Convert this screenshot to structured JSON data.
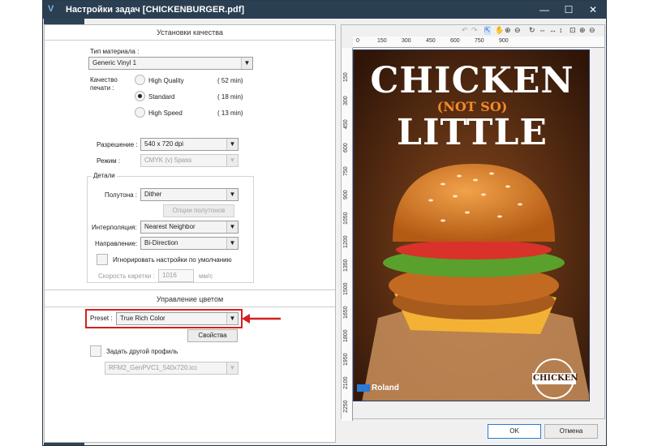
{
  "window": {
    "title": "Настройки задач [CHICKENBURGER.pdf]",
    "controls": {
      "minimize": "—",
      "maximize": "☐",
      "close": "✕"
    }
  },
  "sidebar": {
    "items": [
      {
        "icon": "layout-icon",
        "active": false
      },
      {
        "icon": "quality-icon",
        "active": true
      },
      {
        "icon": "ink-drops-icon",
        "active": false
      },
      {
        "icon": "color-swatch-icon",
        "active": false
      },
      {
        "icon": "shrink-icon",
        "active": false
      },
      {
        "icon": "wrench-icon",
        "active": false
      },
      {
        "icon": "scissors-icon",
        "active": false
      },
      {
        "icon": "clock-icon",
        "active": false
      },
      {
        "icon": "crop-icon",
        "active": false
      },
      {
        "icon": "pages-icon",
        "active": false
      }
    ]
  },
  "quality": {
    "section_title": "Установки качества",
    "material_label": "Тип материала :",
    "material_value": "Generic Vinyl 1",
    "print_quality_label_1": "Качество",
    "print_quality_label_2": "печати :",
    "options": [
      {
        "label": "High Quality",
        "time": "( 52 min)",
        "selected": false
      },
      {
        "label": "Standard",
        "time": "( 18 min)",
        "selected": true
      },
      {
        "label": "High Speed",
        "time": "( 13 min)",
        "selected": false
      }
    ],
    "resolution_label": "Разрешение :",
    "resolution_value": "540 x 720 dpi",
    "mode_label": "Режим :",
    "mode_value": "CMYK (v) 5pass",
    "details_title": "Детали",
    "halftone_label": "Полутона :",
    "halftone_value": "Dither",
    "halftone_options_button": "Опции полутонов",
    "interpolation_label": "Интерполяция:",
    "interpolation_value": "Nearest Neighbor",
    "direction_label": "Направление:",
    "direction_value": "Bi-Direction",
    "ignore_defaults_label": "Игнорировать настройки по умолчанию",
    "carriage_speed_label": "Скорость каретки :",
    "carriage_speed_value": "1016",
    "carriage_speed_unit": "мм/с"
  },
  "color": {
    "section_title": "Управление цветом",
    "preset_label": "Preset :",
    "preset_value": "True Rich Color",
    "properties_button": "Свойства",
    "other_profile_label": "Задать другой профиль",
    "profile_value": "RFM2_GenPVC1_540x720.icc"
  },
  "preview": {
    "toolbar_icons": [
      "undo-icon",
      "redo-icon",
      "select-icon",
      "hand-icon",
      "zoom-in-tool-icon",
      "zoom-out-tool-icon",
      "rotate-icon",
      "flip-icon",
      "fit-width-icon",
      "fit-height-icon",
      "zoom-fit-icon",
      "zoom-plus-icon",
      "zoom-minus-icon"
    ],
    "ruler_h": [
      "0",
      "150",
      "300",
      "450",
      "600",
      "750",
      "900"
    ],
    "ruler_v": [
      "150",
      "300",
      "450",
      "600",
      "750",
      "900",
      "1050",
      "1200",
      "1350",
      "1500",
      "1650",
      "1800",
      "1950",
      "2100",
      "2250"
    ],
    "poster": {
      "line1": "CHICKEN",
      "line2": "(NOT SO)",
      "line3": "LITTLE",
      "brand": "Roland",
      "stamp": "CHICKEN"
    }
  },
  "footer": {
    "ok_button": "OK",
    "cancel_button": "Отмена"
  },
  "colors": {
    "sidebar": "#2d4257",
    "accent": "#1a73d9",
    "highlight_red": "#d42020"
  }
}
